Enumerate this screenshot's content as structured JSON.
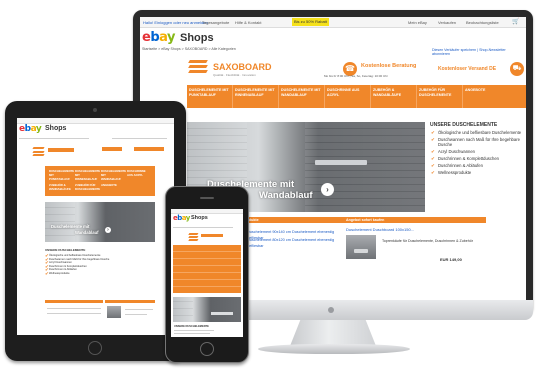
{
  "monitor": {
    "topbar": {
      "greeting": "Hallo! Einloggen oder neu anmelden",
      "deals": "Tagesangebote",
      "service": "Hilfe & Kontakt",
      "promo": "Bis zu 50% Rabatt",
      "mybay": "Mein eBay",
      "sell": "Verkaufen",
      "watch": "Beobachtungsliste"
    },
    "header": {
      "logo": {
        "e": "e",
        "b": "b",
        "a": "a",
        "y": "y"
      },
      "shops": "Shops",
      "breadcrumb": "Startseite > eBay Shops > SAXOBOARD > Alle Kategorien",
      "newsletter": "Diesen Verkäufer speichern | Shop-Newsletter abonnieren"
    },
    "brand": {
      "name": "SAXOBOARD",
      "tagline": "Qualität · Flexibilität · Innovation",
      "consult_title": "Kostenlose Beratung",
      "consult_hours": "Mo bis Fr 8:00 Uhr | Sa, So, Feiertag: 10:00 Uhr",
      "shipping": "Kostenloser Versand DE"
    },
    "nav": [
      "DUSCHELEMENTE MIT PUNKTABLAUF",
      "DUSCHELEMENTE MIT RINNENABLAUF",
      "DUSCHELEMENTE MIT WANDABLAUF",
      "DUSCHRINNE AUS ACRYL",
      "ZUBEHÖR & WANDABLÄUFE",
      "ZUBEHÖR FÜR DUSCHELEMENTE",
      "ANGEBOTE"
    ],
    "hero_caption_line1": "Duschelemente mit",
    "hero_caption_line2": "Wandablauf",
    "sidebar": {
      "title": "UNSERE DUSCHELEMENTE",
      "items": [
        "Ökologische und befliesbare Duschelemente",
        "Duschwannen nach Maß für Ihre begehbare Dusche",
        "Acryl Duschwannen",
        "Duschrinnen & Komplettduschen",
        "Duschrinnen & Abläufen",
        "Wellnessprodukte"
      ]
    },
    "products": {
      "left_header": "Produkte",
      "left_lines": [
        "Duschelement 90x140 cm Duschelement ebenerdig befliesbar",
        "Duschelement 80x120 cm Duschelement ebenerdig befliesbar"
      ],
      "right_header": "Angebot sofort kaufen",
      "right_title": "Duschelement Duschboard 100x150...",
      "right_desc": "Toprenkäufe für Duschelemente, Duschrinnen & Zubehör",
      "right_price": "EUR 149,00"
    }
  },
  "tablet": {
    "logo": {
      "e": "e",
      "b": "b",
      "a": "a",
      "y": "y"
    },
    "shops": "Shops",
    "nav": [
      "DUSCHELEMENTE MIT PUNKTABLAUF",
      "DUSCHELEMENTE MIT RINNENABLAUF",
      "DUSCHELEMENTE MIT WANDABLAUF",
      "DUSCHRINNE AUS ACRYL",
      "ZUBEHÖR & WANDABLÄUFE",
      "ZUBEHÖR FÜR DUSCHELEMENTE",
      "ANGEBOTE"
    ],
    "hero_caption_line1": "Duschelemente mit",
    "hero_caption_line2": "Wandablauf",
    "list_title": "UNSERE DUSCHELEMENTE",
    "list_items": [
      "Ökologische und befliesbare Duschelemente",
      "Duschwannen nach Maß für Ihre begehbare Dusche",
      "Acryl Duschwannen",
      "Duschrinnen & Komplettduschen",
      "Duschrinnen & Abläufen",
      "Wellnessprodukte"
    ]
  },
  "phone": {
    "logo": {
      "e": "e",
      "b": "b",
      "a": "a",
      "y": "y"
    },
    "shops": "Shops",
    "list_title": "UNSERE DUSCHELEMENTE"
  },
  "colors": {
    "accent": "#f0872a",
    "ebay_red": "#e53238",
    "ebay_blue": "#0064d2",
    "ebay_yellow": "#f5af02",
    "ebay_green": "#86b817",
    "device_frame": "#1e1e1e"
  }
}
